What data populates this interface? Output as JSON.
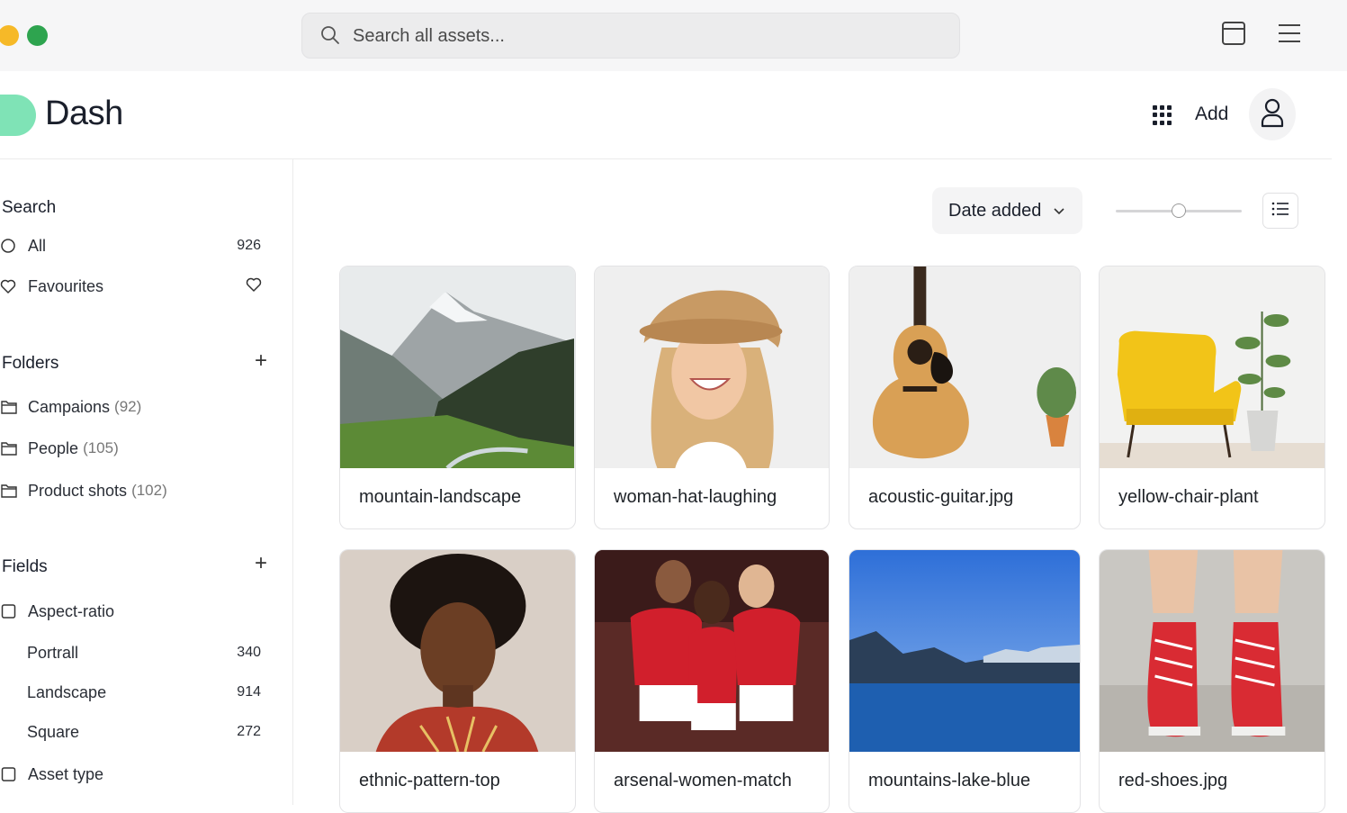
{
  "search": {
    "placeholder": "Search all assets..."
  },
  "brand": {
    "name": "Dash",
    "logo_color": "#7fe3b6"
  },
  "header": {
    "add_label": "Add"
  },
  "sidebar": {
    "search_title": "Search",
    "all": {
      "label": "All",
      "count": "926"
    },
    "favourites": {
      "label": "Favourites"
    },
    "folders_title": "Folders",
    "folders": [
      {
        "label": "Campaions",
        "count": "(92)"
      },
      {
        "label": "People",
        "count": "(105)"
      },
      {
        "label": "Product shots",
        "count": "(102)"
      }
    ],
    "fields_title": "Fields",
    "aspect": {
      "label": "Aspect-ratio"
    },
    "aspect_items": [
      {
        "label": "Portrall",
        "count": "340"
      },
      {
        "label": "Landscape",
        "count": "914"
      },
      {
        "label": "Square",
        "count": "272"
      }
    ],
    "asset_type": {
      "label": "Asset type"
    }
  },
  "toolbar": {
    "sort_label": "Date added",
    "zoom_fraction": 0.5
  },
  "assets": [
    {
      "name": "mountain-landscape"
    },
    {
      "name": "woman-hat-laughing"
    },
    {
      "name": "acoustic-guitar.jpg"
    },
    {
      "name": "yellow-chair-plant"
    },
    {
      "name": "ethnic-pattern-top"
    },
    {
      "name": "arsenal-women-match"
    },
    {
      "name": "mountains-lake-blue"
    },
    {
      "name": "red-shoes.jpg"
    }
  ]
}
